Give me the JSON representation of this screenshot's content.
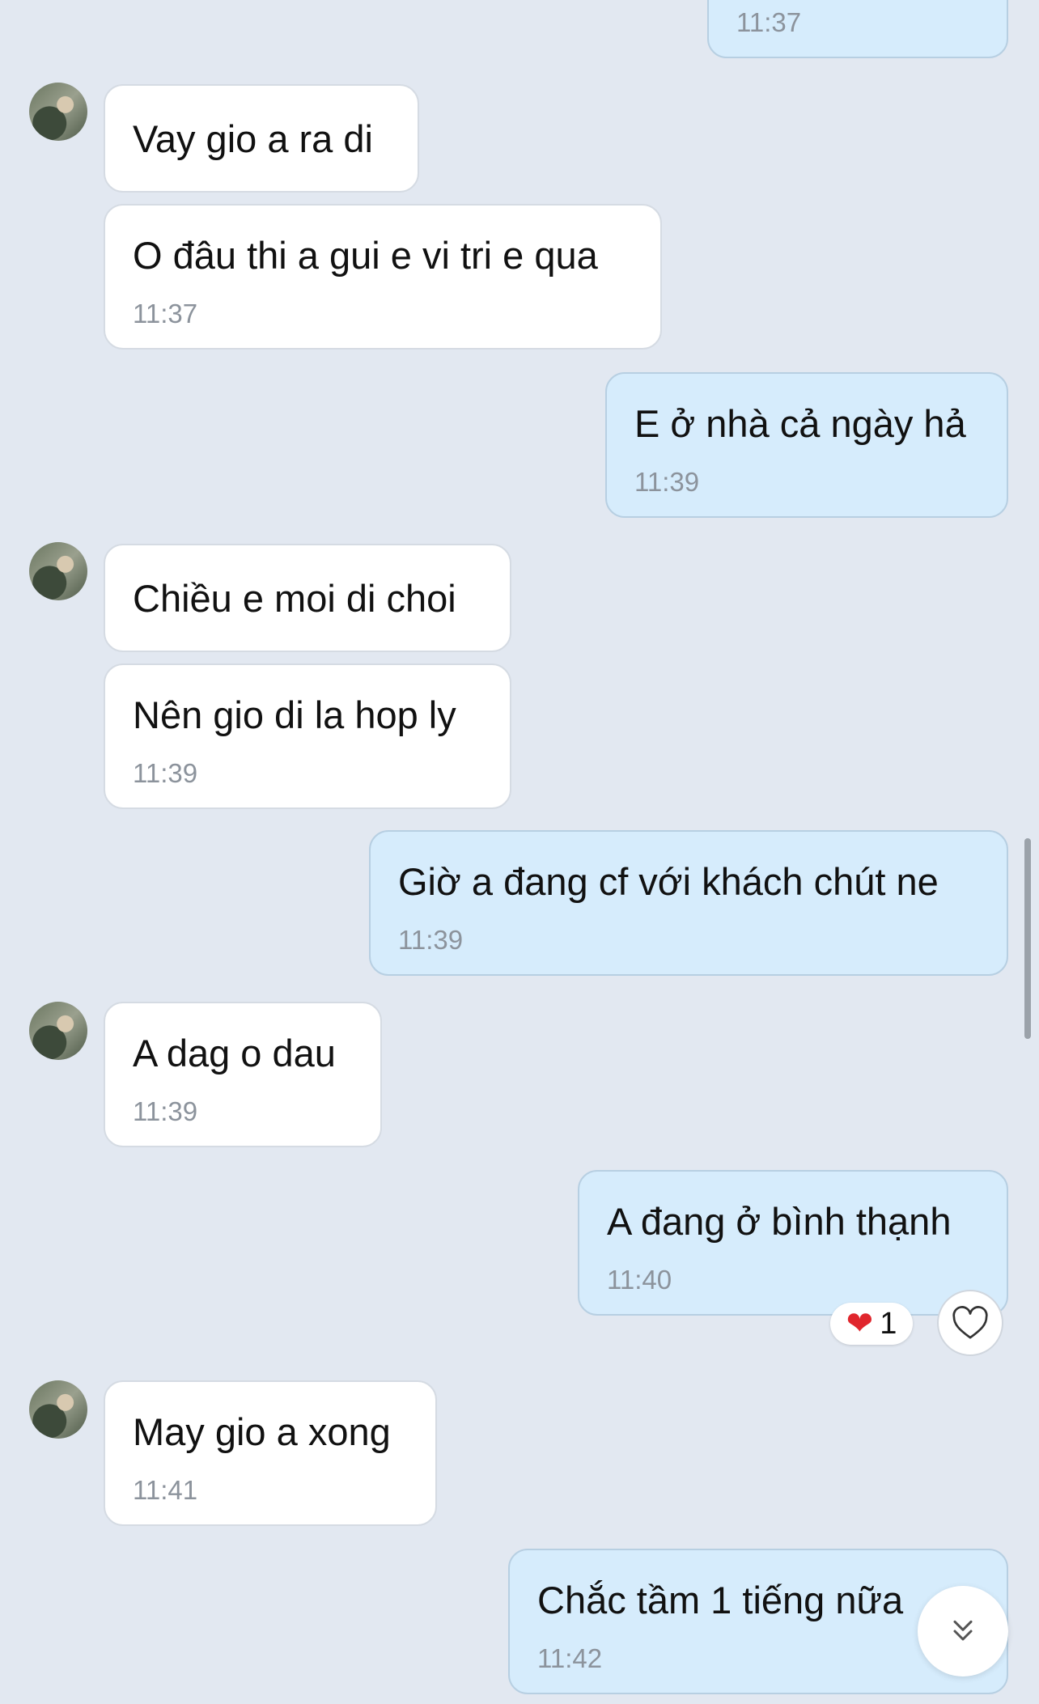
{
  "colors": {
    "background": "#e2e8f1",
    "incoming_bubble": "#ffffff",
    "outgoing_bubble": "#d6ecfc",
    "timestamp": "#8c939c",
    "reaction_heart": "#e0262d"
  },
  "messages": [
    {
      "direction": "out",
      "text": "",
      "time": "11:37"
    },
    {
      "direction": "in",
      "text": "Vay gio a ra di",
      "time": ""
    },
    {
      "direction": "in",
      "text": "O đâu thi a gui e vi tri e qua",
      "time": "11:37"
    },
    {
      "direction": "out",
      "text": "E ở nhà cả ngày hả",
      "time": "11:39"
    },
    {
      "direction": "in",
      "text": "Chiều e moi di choi",
      "time": ""
    },
    {
      "direction": "in",
      "text": "Nên gio di la hop ly",
      "time": "11:39"
    },
    {
      "direction": "out",
      "text": "Giờ a đang cf với khách chút ne",
      "time": "11:39"
    },
    {
      "direction": "in",
      "text": "A dag o dau",
      "time": "11:39"
    },
    {
      "direction": "out",
      "text": "A đang ở bình thạnh",
      "time": "11:40"
    },
    {
      "direction": "in",
      "text": "May gio a xong",
      "time": "11:41"
    },
    {
      "direction": "out",
      "text": "Chắc tầm 1 tiếng nữa",
      "time": "11:42"
    }
  ],
  "reaction": {
    "icon": "heart-emoji",
    "count": "1"
  },
  "icons": {
    "react": "heart-outline-icon",
    "scroll_down": "double-chevron-down-icon"
  }
}
